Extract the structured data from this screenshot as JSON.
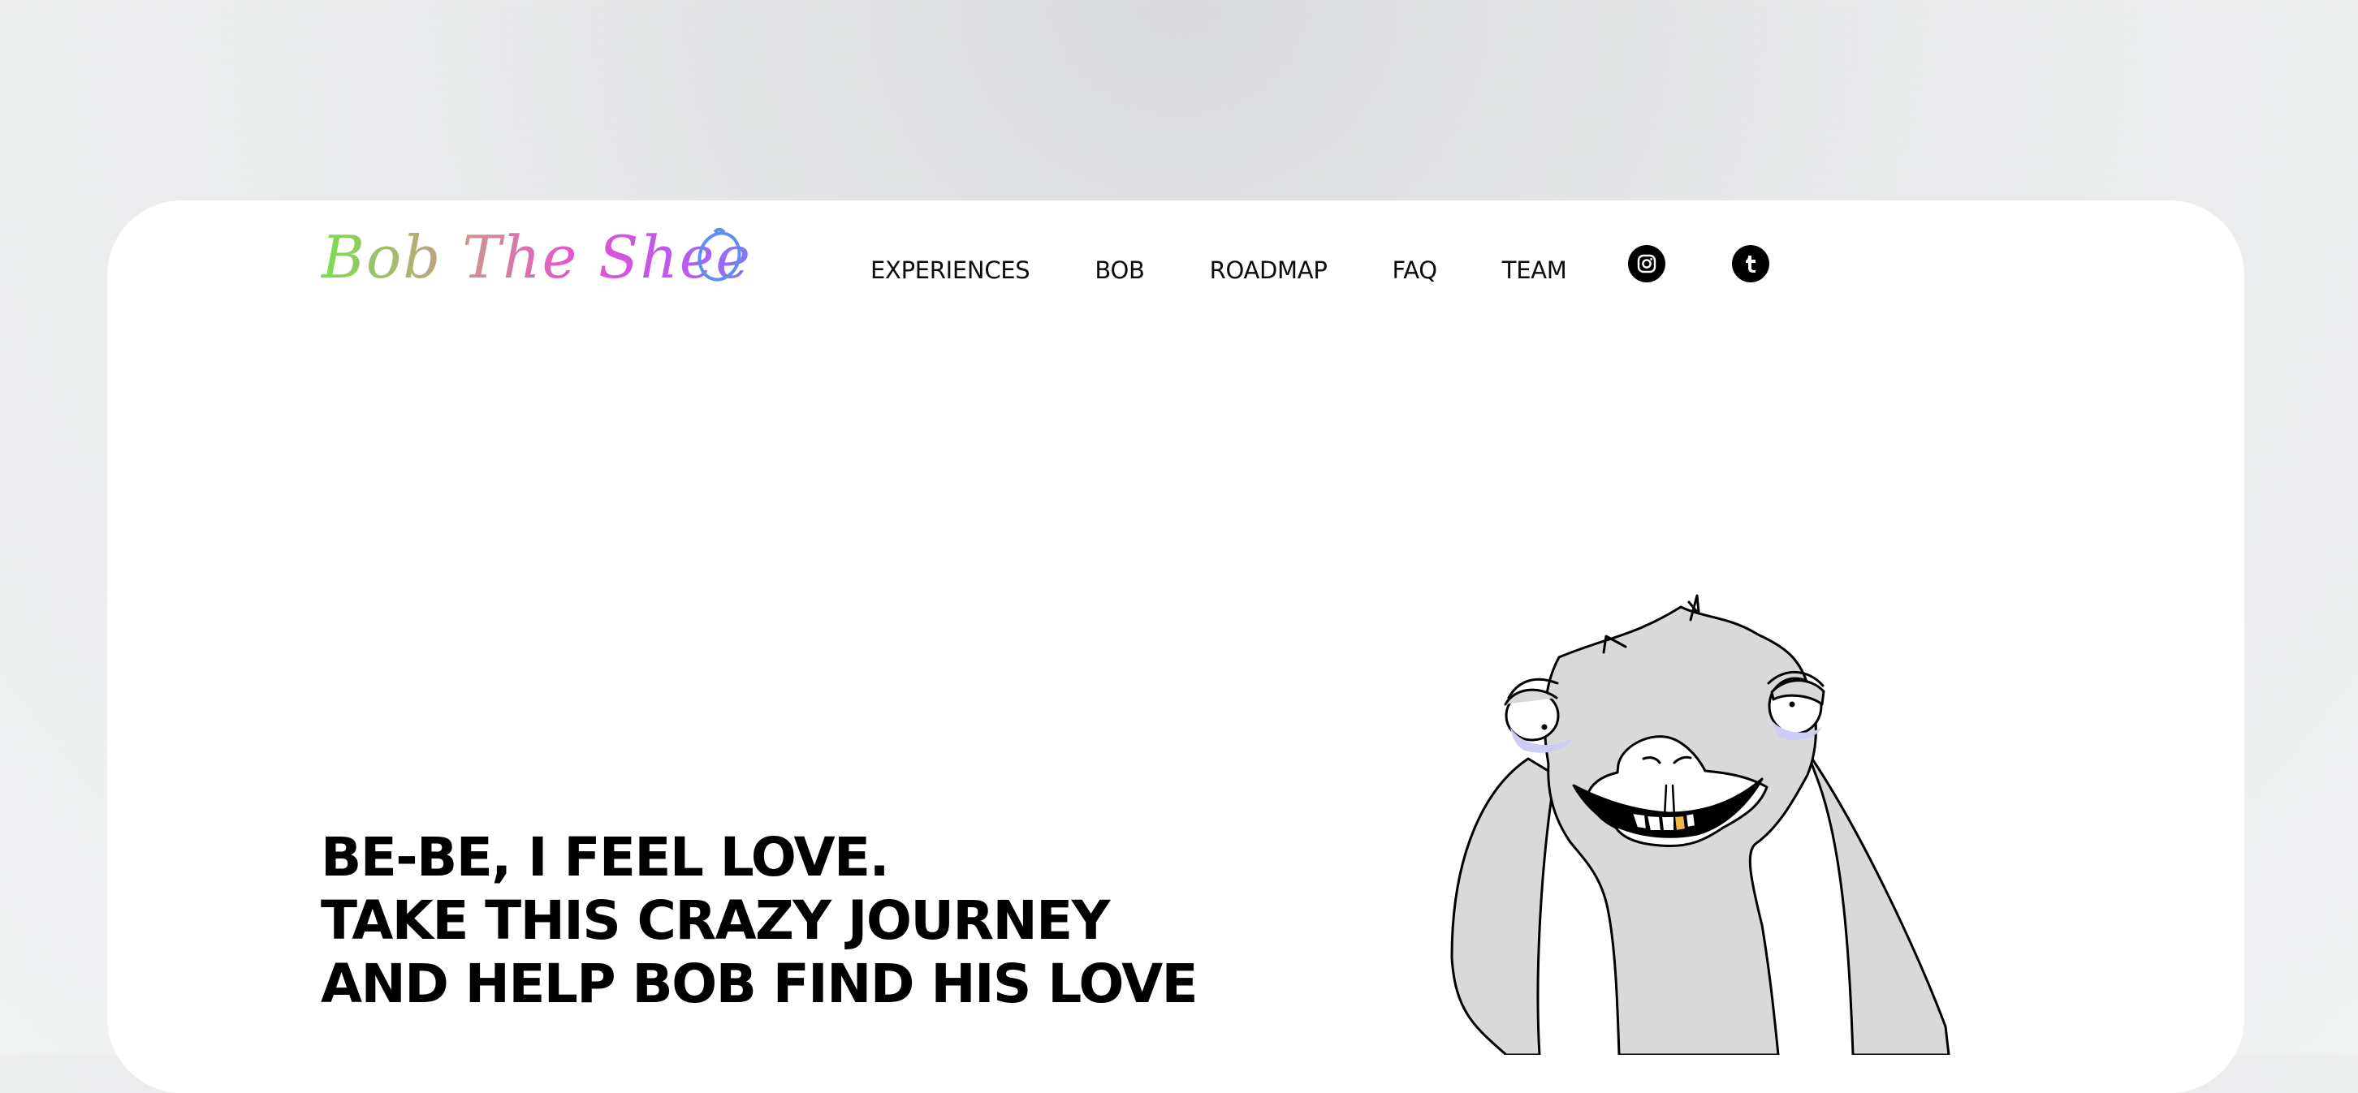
{
  "brand": {
    "logo_text": "Bob The Sheep",
    "gradient_colors": [
      "#7ddd4e",
      "#c99a8b",
      "#e84fd1",
      "#b45cf2",
      "#5d8ef0"
    ]
  },
  "nav": {
    "items": [
      {
        "label": "EXPERIENCES"
      },
      {
        "label": "BOB"
      },
      {
        "label": "ROADMAP"
      },
      {
        "label": "FAQ"
      },
      {
        "label": "TEAM"
      }
    ],
    "social": [
      {
        "icon": "instagram-icon"
      },
      {
        "icon": "tumblr-icon"
      }
    ]
  },
  "hero": {
    "lines": [
      "BE-BE, I FEEL LOVE.",
      "TAKE THIS CRAZY JOURNEY",
      "AND HELP BOB FIND HIS LOVE"
    ]
  },
  "illustration": {
    "name": "sheep-illustration",
    "fill": "#d9d9d9",
    "eye_shadow": "#ccccf5",
    "tooth_accent": "#f2b544"
  }
}
